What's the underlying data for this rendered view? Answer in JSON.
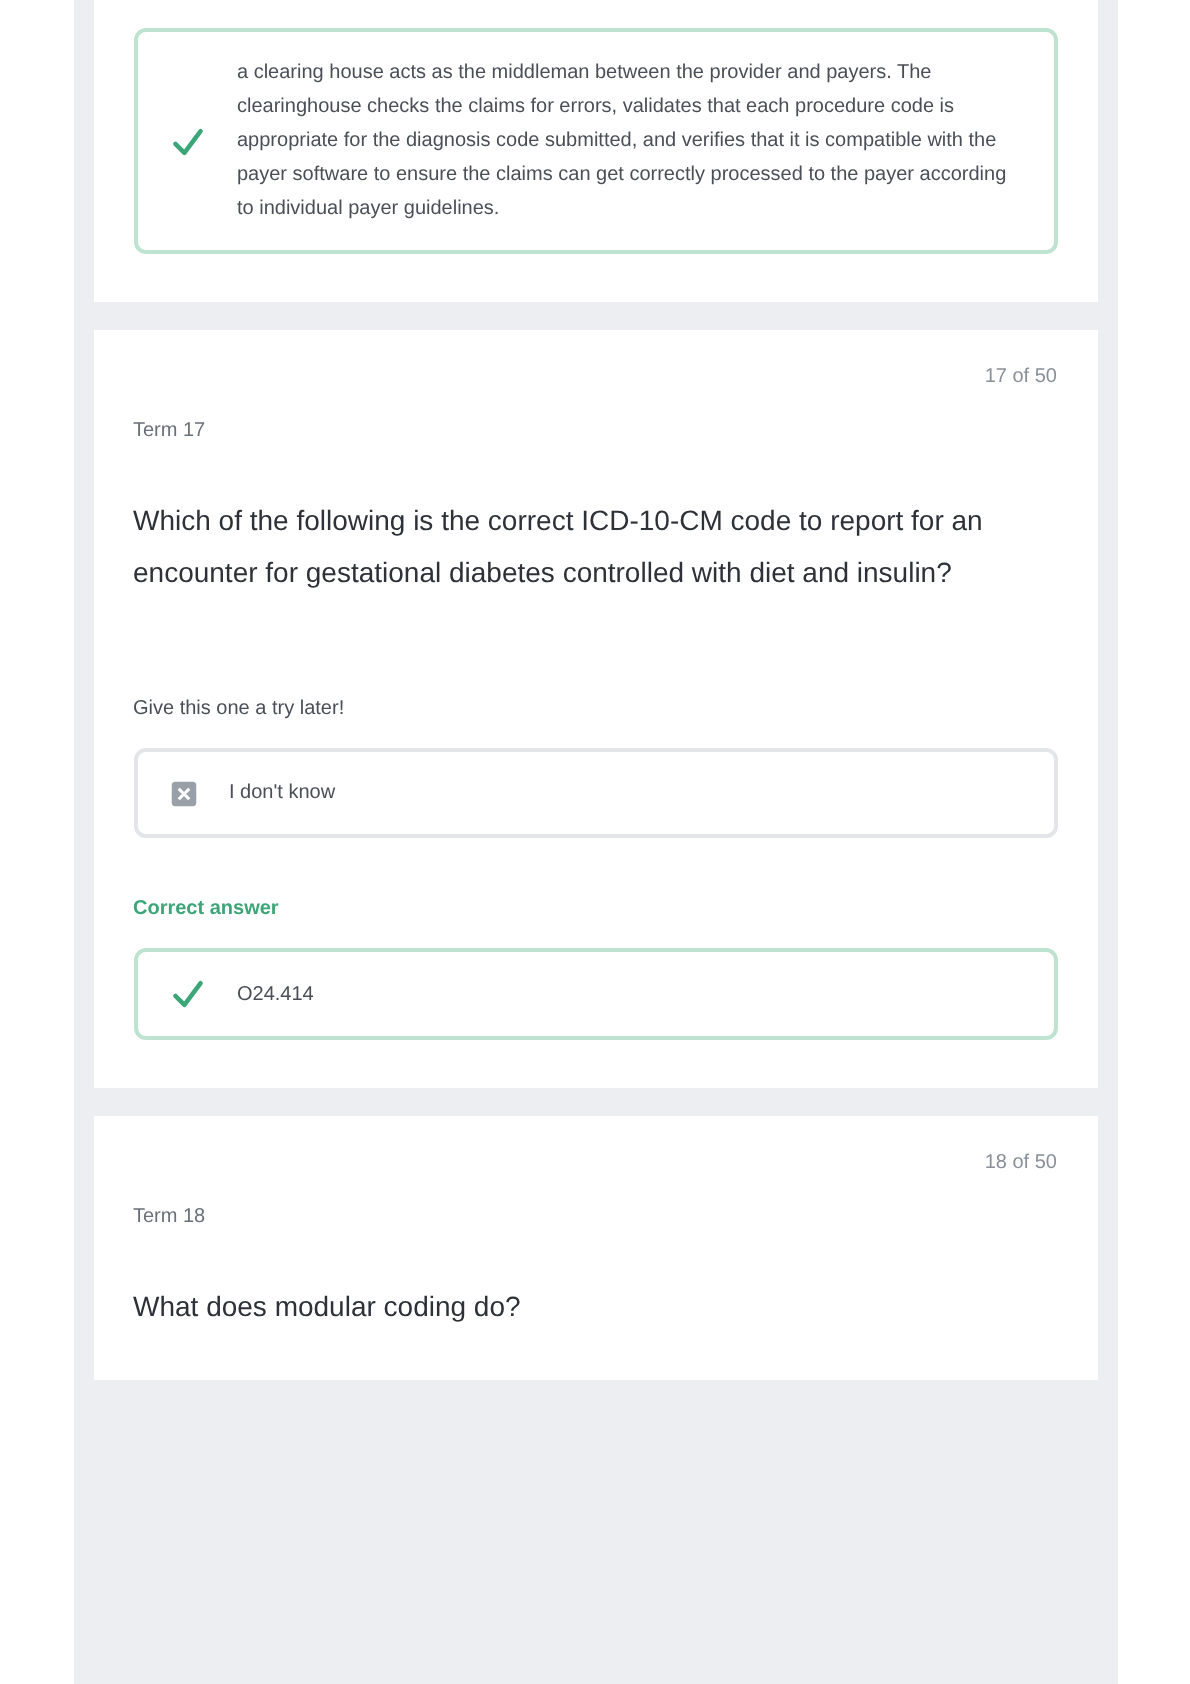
{
  "cards": [
    {
      "answers": [
        {
          "kind": "correct",
          "text": "a clearing house acts as the middleman between the provider and payers. The clearinghouse checks the claims for errors, validates that each procedure code is appropriate for the diagnosis code submitted, and verifies that it is compatible with the payer software to ensure the claims can get correctly processed to the payer according to individual payer guidelines."
        }
      ]
    },
    {
      "counter": "17 of 50",
      "term": "Term 17",
      "question": "Which of the following is the correct ICD-10-CM code to report for an encounter for gestational diabetes controlled with diet and insulin?",
      "prompt": "Give this one a try later!",
      "answers": [
        {
          "kind": "skipped",
          "text": "I don't know"
        }
      ],
      "correct_label": "Correct answer",
      "correct": [
        {
          "kind": "correct",
          "text": "O24.414"
        }
      ]
    },
    {
      "counter": "18 of 50",
      "term": "Term 18",
      "question": "What does modular coding do?"
    }
  ]
}
